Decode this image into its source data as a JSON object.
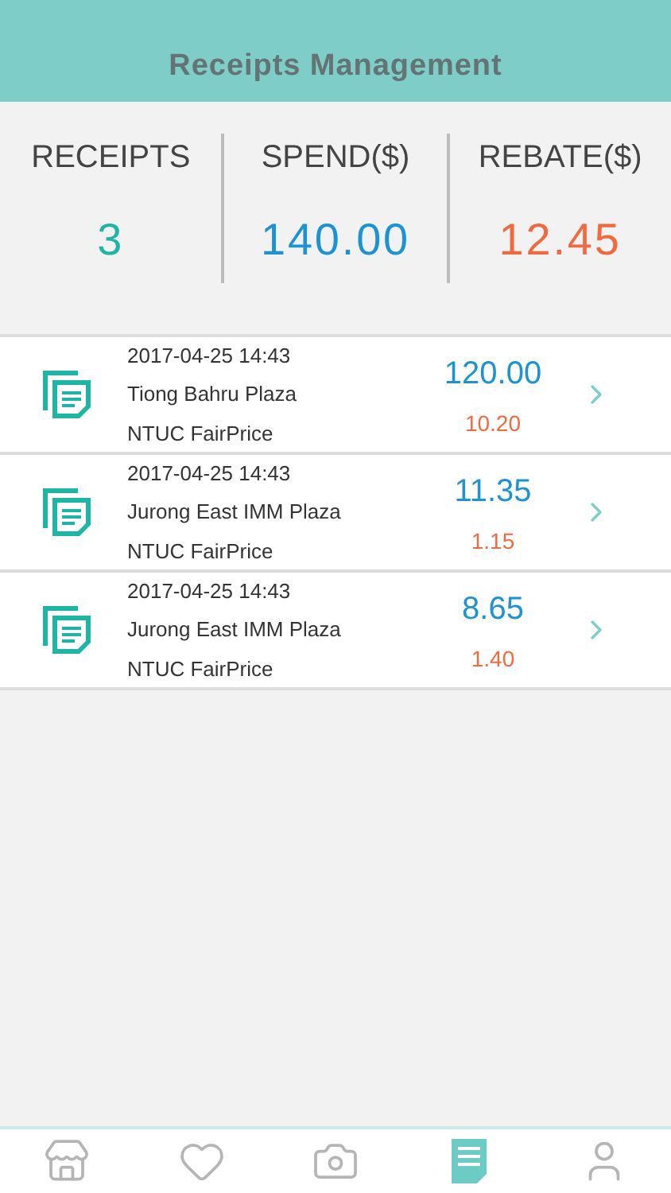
{
  "header": {
    "title": "Receipts Management"
  },
  "summary": [
    {
      "label": "RECEIPTS",
      "value": "3",
      "kind": "count"
    },
    {
      "label": "SPEND($)",
      "value": "140.00",
      "kind": "spend"
    },
    {
      "label": "REBATE($)",
      "value": "12.45",
      "kind": "rebate"
    }
  ],
  "receipts": [
    {
      "datetime": "2017-04-25 14:43",
      "location": "Tiong Bahru Plaza",
      "merchant": "NTUC FairPrice",
      "spend": "120.00",
      "rebate": "10.20"
    },
    {
      "datetime": "2017-04-25 14:43",
      "location": "Jurong East IMM Plaza",
      "merchant": "NTUC FairPrice",
      "spend": "11.35",
      "rebate": "1.15"
    },
    {
      "datetime": "2017-04-25 14:43",
      "location": "Jurong East IMM Plaza",
      "merchant": "NTUC FairPrice",
      "spend": "8.65",
      "rebate": "1.40"
    }
  ],
  "tab_bar": [
    {
      "kind": "store",
      "selected": false
    },
    {
      "kind": "favorites",
      "selected": false
    },
    {
      "kind": "camera",
      "selected": false
    },
    {
      "kind": "receipts",
      "selected": true
    },
    {
      "kind": "profile",
      "selected": false
    }
  ]
}
